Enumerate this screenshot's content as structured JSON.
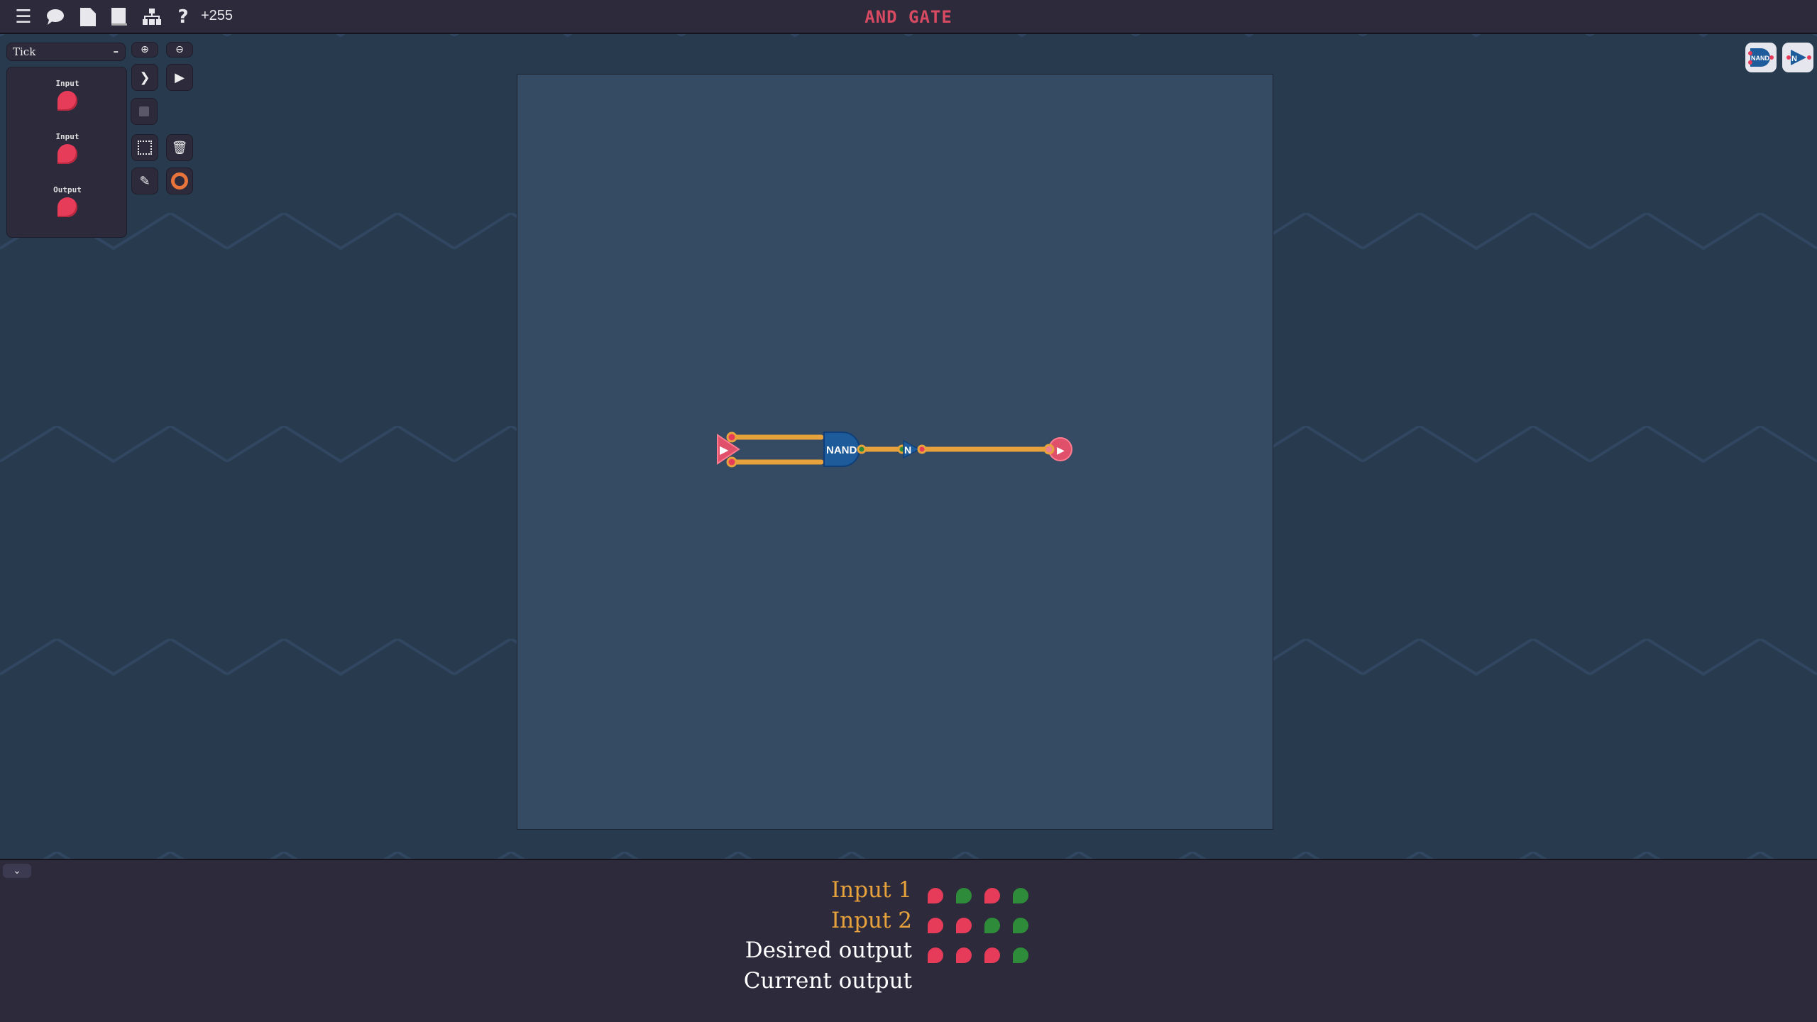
{
  "topbar": {
    "icons": [
      "menu-icon",
      "chat-icon",
      "file-icon",
      "book-icon",
      "hierarchy-icon",
      "help-icon"
    ],
    "score": "+255",
    "title": "AND GATE"
  },
  "sidebar": {
    "dropdown_value": "Tick",
    "dropdown_toggle": "–",
    "palette": [
      {
        "label": "Input"
      },
      {
        "label": "Input"
      },
      {
        "label": "Output"
      }
    ]
  },
  "canvas": {
    "components": [
      {
        "type": "input",
        "label": ""
      },
      {
        "type": "nand",
        "label": "NAND"
      },
      {
        "type": "not",
        "label": "N"
      },
      {
        "type": "output",
        "label": ""
      }
    ]
  },
  "custom_gates": [
    "NAND",
    "N"
  ],
  "truth_table": {
    "rows": [
      {
        "label": "Input 1",
        "values": [
          0,
          1,
          0,
          1
        ],
        "color": "#e8a23c"
      },
      {
        "label": "Input 2",
        "values": [
          0,
          0,
          1,
          1
        ],
        "color": "#e8a23c"
      },
      {
        "label": "Desired output",
        "values": [
          0,
          0,
          0,
          1
        ],
        "color": "#ffffff"
      },
      {
        "label": "Current output",
        "values": [],
        "color": "#ffffff"
      }
    ]
  },
  "colors": {
    "off": "#e63c5a",
    "on": "#2e8b3a",
    "wire": "#e8a23c",
    "gate": "#1e5b9a",
    "title": "#d84a62"
  }
}
